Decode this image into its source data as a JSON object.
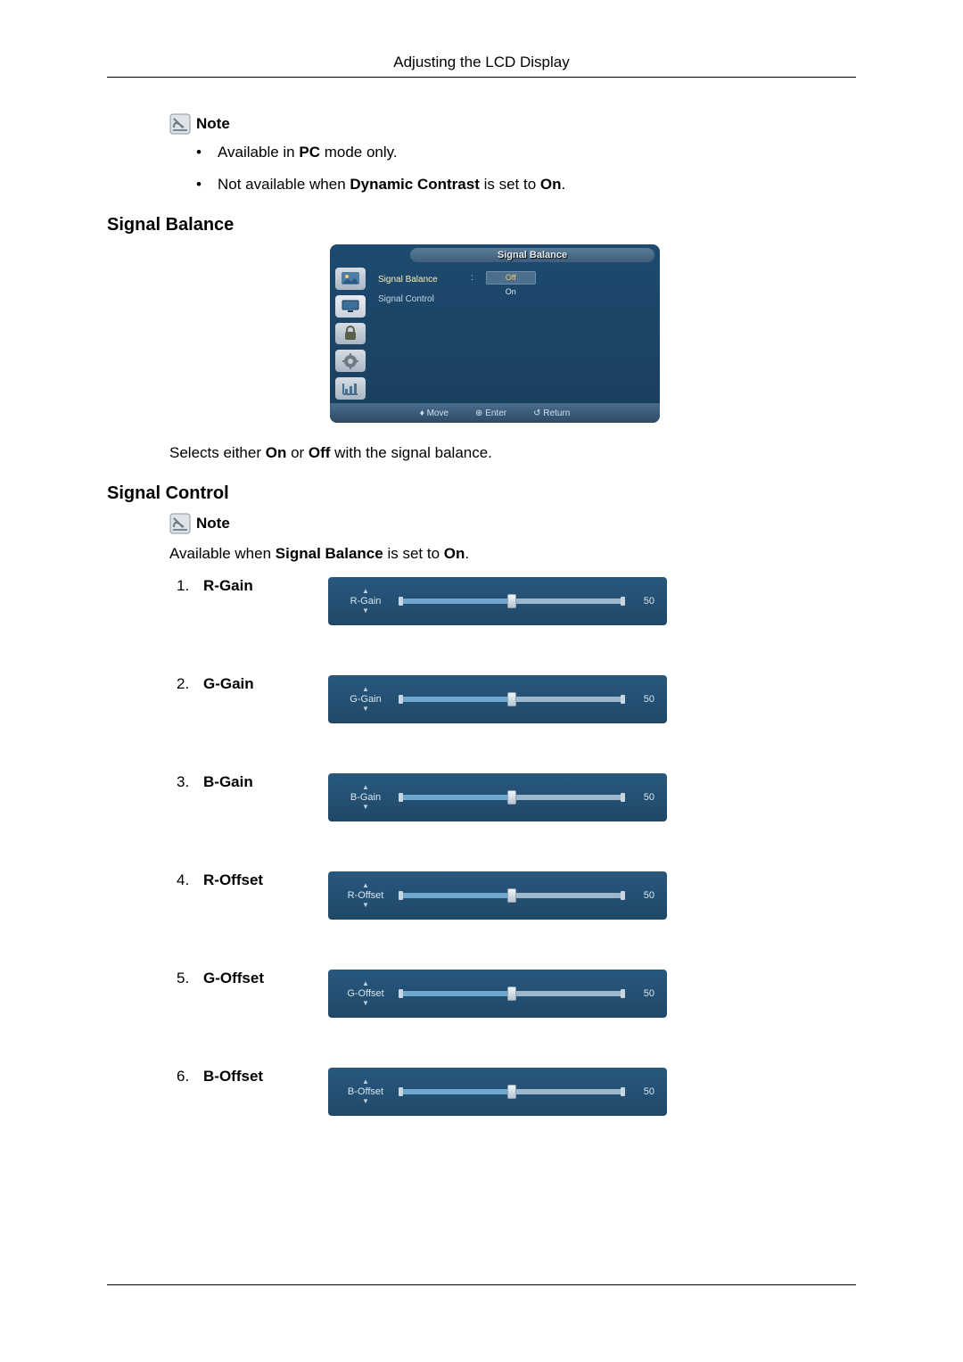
{
  "header": {
    "title": "Adjusting the LCD Display"
  },
  "note1": {
    "label": "Note",
    "bullets": {
      "b1_pre": "Available in ",
      "b1_bold": "PC",
      "b1_post": " mode only.",
      "b2_pre": "Not available when ",
      "b2_bold": "Dynamic Contrast",
      "b2_mid": " is set to ",
      "b2_bold2": "On",
      "b2_post": "."
    }
  },
  "section_signal_balance": {
    "heading": "Signal Balance",
    "osd": {
      "title": "Signal Balance",
      "row1": "Signal Balance",
      "row2": "Signal Control",
      "opt_off": "Off",
      "opt_on": "On",
      "foot_move": "Move",
      "foot_enter": "Enter",
      "foot_return": "Return"
    },
    "desc_pre": "Selects either ",
    "desc_b1": "On",
    "desc_mid": " or ",
    "desc_b2": "Off",
    "desc_post": " with the signal balance."
  },
  "section_signal_control": {
    "heading": "Signal Control",
    "note_label": "Note",
    "avail_pre": "Available when ",
    "avail_b1": "Signal Balance",
    "avail_mid": " is set to ",
    "avail_b2": "On",
    "avail_post": ".",
    "items": [
      {
        "num": "1.",
        "label": "R-Gain",
        "slider_label": "R-Gain",
        "value": "50"
      },
      {
        "num": "2.",
        "label": "G-Gain",
        "slider_label": "G-Gain",
        "value": "50"
      },
      {
        "num": "3.",
        "label": "B-Gain",
        "slider_label": "B-Gain",
        "value": "50"
      },
      {
        "num": "4.",
        "label": "R-Offset",
        "slider_label": "R-Offset",
        "value": "50"
      },
      {
        "num": "5.",
        "label": "G-Offset",
        "slider_label": "G-Offset",
        "value": "50"
      },
      {
        "num": "6.",
        "label": "B-Offset",
        "slider_label": "B-Offset",
        "value": "50"
      }
    ]
  }
}
